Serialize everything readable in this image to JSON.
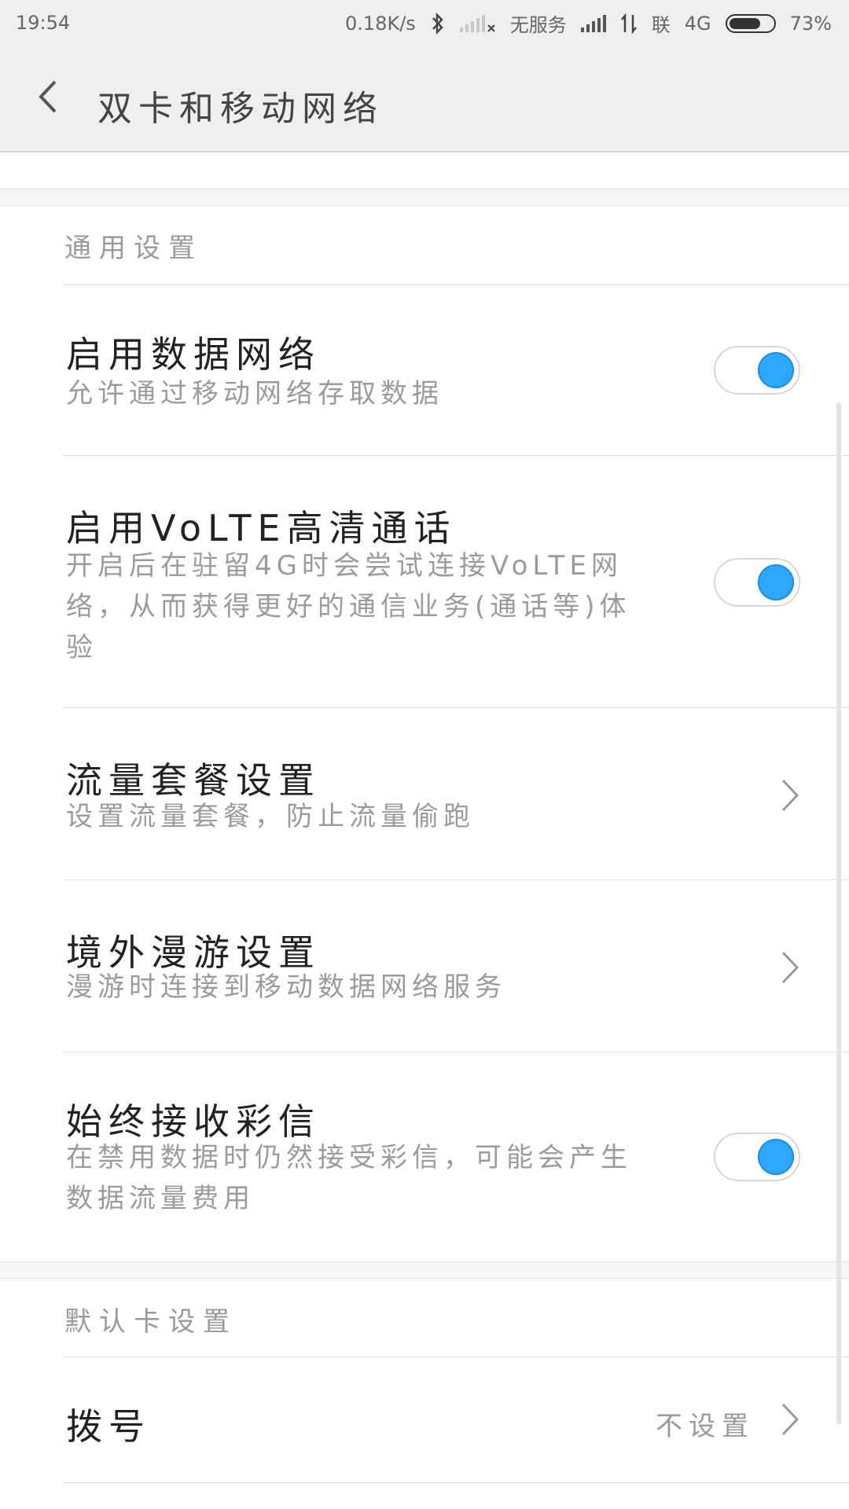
{
  "status_bar": {
    "time": "19:54",
    "net_speed": "0.18K/s",
    "sim1_status": "无服务",
    "sim2_label": "联",
    "network_type": "4G",
    "battery_percent": "73%",
    "battery_level": 0.73,
    "icons": [
      "bluetooth-icon",
      "signal-empty-icon",
      "signal-full-icon",
      "data-arrows-icon",
      "battery-icon"
    ]
  },
  "header": {
    "title": "双卡和移动网络",
    "back_icon": "chevron-left-icon"
  },
  "general_section": {
    "header": "通用设置",
    "items": [
      {
        "title": "启用数据网络",
        "subtitle": "允许通过移动网络存取数据",
        "control": "toggle",
        "on": true
      },
      {
        "title": "启用VoLTE高清通话",
        "subtitle": "开启后在驻留4G时会尝试连接VoLTE网络，从而获得更好的通信业务(通话等)体验",
        "control": "toggle",
        "on": true
      },
      {
        "title": "流量套餐设置",
        "subtitle": "设置流量套餐，防止流量偷跑",
        "control": "chevron"
      },
      {
        "title": "境外漫游设置",
        "subtitle": "漫游时连接到移动数据网络服务",
        "control": "chevron"
      },
      {
        "title": "始终接收彩信",
        "subtitle": "在禁用数据时仍然接受彩信，可能会产生数据流量费用",
        "control": "toggle",
        "on": true
      }
    ]
  },
  "default_card_section": {
    "header": "默认卡设置",
    "items": [
      {
        "title": "拨号",
        "value": "不设置",
        "control": "chevron"
      }
    ]
  },
  "colors": {
    "accent": "#2ea7ff",
    "header_bg": "#efefef",
    "title_text": "#222222",
    "subtitle_text": "#9b9b9b"
  }
}
